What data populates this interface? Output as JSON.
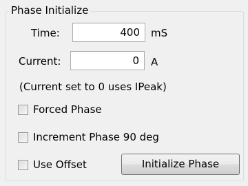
{
  "group": {
    "title": "Phase Initialize"
  },
  "time": {
    "label": "Time:",
    "value": "400",
    "unit": "mS"
  },
  "current": {
    "label": "Current:",
    "value": "0",
    "unit": "A"
  },
  "note": "(Current set to 0 uses IPeak)",
  "checkboxes": [
    {
      "label": "Forced Phase",
      "checked": false
    },
    {
      "label": "Increment Phase 90 deg",
      "checked": false
    },
    {
      "label": "Use Offset",
      "checked": false
    }
  ],
  "button": {
    "label": "Initialize Phase"
  }
}
